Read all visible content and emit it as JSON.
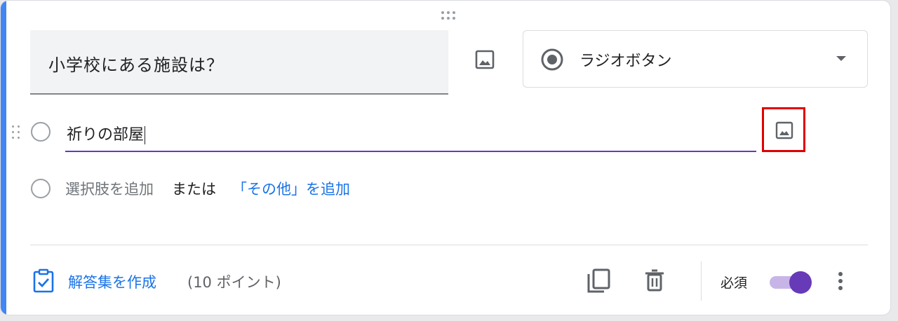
{
  "question": {
    "title": "小学校にある施設は？",
    "type_selected": "ラジオボタン",
    "image_icon": "image-icon"
  },
  "options": [
    {
      "value": "祈りの部屋"
    }
  ],
  "add_option": {
    "add_label": "選択肢を追加",
    "or_label": "または",
    "add_other_label": "「その他」を追加"
  },
  "footer": {
    "answer_key_label": "解答集を作成",
    "points_label": "(10 ポイント)",
    "required_label": "必須",
    "required_on": true
  },
  "colors": {
    "accent": "#4285f4",
    "purple": "#673ab7",
    "link": "#1a73e8",
    "highlight_box": "#e00000"
  }
}
